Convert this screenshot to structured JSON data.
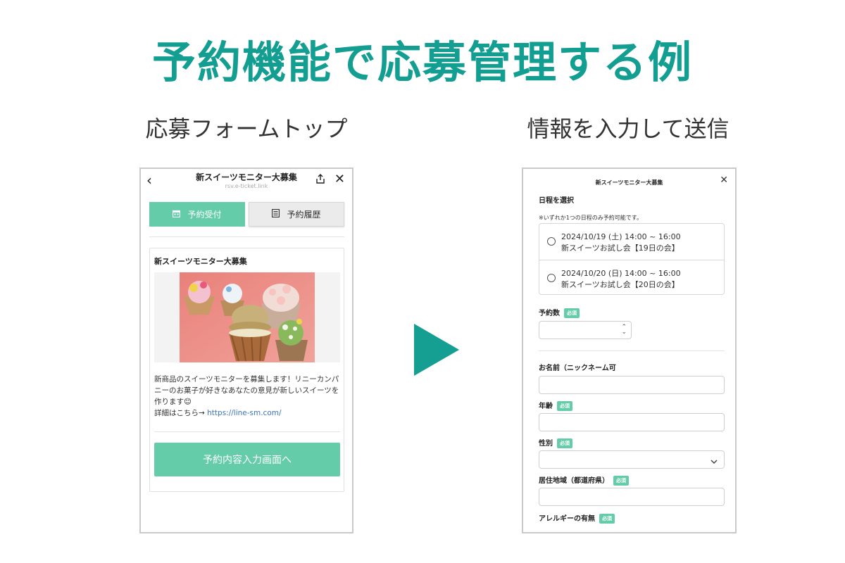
{
  "main_title": "予約機能で応募管理する例",
  "left_caption": "応募フォームトップ",
  "right_caption": "情報を入力して送信",
  "left_phone": {
    "header_title": "新スイーツモニター大募集",
    "header_url": "rsv.e-ticket.link",
    "back_icon": "chevron-left-icon",
    "share_icon": "share-icon",
    "close_icon": "close-icon",
    "tabs": [
      {
        "label": "予約受付",
        "icon": "calendar-icon",
        "active": true
      },
      {
        "label": "予約履歴",
        "icon": "list-icon",
        "active": false
      }
    ],
    "card_title": "新スイーツモニター大募集",
    "desc_text": "新商品のスイーツモニターを募集します！リニーカンパニーのお菓子が好きなあなたの意見が新しいスイーツを作ります😊",
    "detail_prefix": "詳細はこちら→ ",
    "detail_link": "https://line-sm.com/",
    "cta_label": "予約内容入力画面へ"
  },
  "right_phone": {
    "header_title": "新スイーツモニター大募集",
    "close_icon": "close-icon",
    "schedule_label": "日程を選択",
    "schedule_note": "※いずれか1つの日程のみ予約可能です。",
    "options": [
      {
        "line1": "2024/10/19 (土) 14:00 ~ 16:00",
        "line2": "新スイーツお試し会【19日の会】"
      },
      {
        "line1": "2024/10/20 (日) 14:00 ~ 16:00",
        "line2": "新スイーツお試し会【20日の会】"
      }
    ],
    "quantity_label": "予約数",
    "required_badge": "必須",
    "name_label": "お名前（ニックネーム可",
    "age_label": "年齢",
    "gender_label": "性別",
    "region_label": "居住地域（都道府県）",
    "allergy_label": "アレルギーの有無"
  },
  "colors": {
    "title": "#139e92",
    "accent": "#65ccaa",
    "arrow": "#159e92"
  }
}
